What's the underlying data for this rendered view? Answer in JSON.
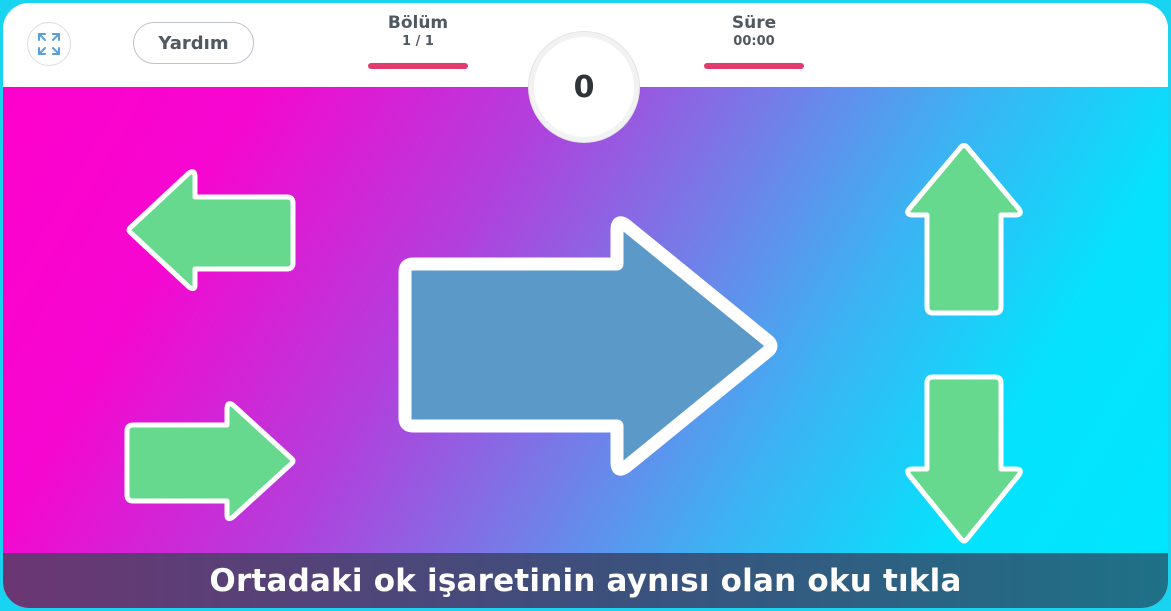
{
  "header": {
    "fullscreen_icon": "expand-arrows-icon",
    "help_label": "Yardım",
    "level": {
      "label": "Bölüm",
      "value": "1 / 1"
    },
    "time": {
      "label": "Süre",
      "value": "00:00"
    },
    "score": "0"
  },
  "game": {
    "target_arrow": {
      "direction": "right",
      "color": "#5b9ac8"
    },
    "options": [
      {
        "direction": "left",
        "color": "#66d98f"
      },
      {
        "direction": "right",
        "color": "#66d98f"
      },
      {
        "direction": "up",
        "color": "#66d98f"
      },
      {
        "direction": "down",
        "color": "#66d98f"
      }
    ]
  },
  "instruction": "Ortadaki ok işaretinin aynısı olan oku tıkla",
  "colors": {
    "progress_bar": "#e23c6e",
    "option_arrow": "#66d98f",
    "target_arrow": "#5b9ac8",
    "gradient_start": "#ff00cc",
    "gradient_end": "#00e6ff"
  }
}
